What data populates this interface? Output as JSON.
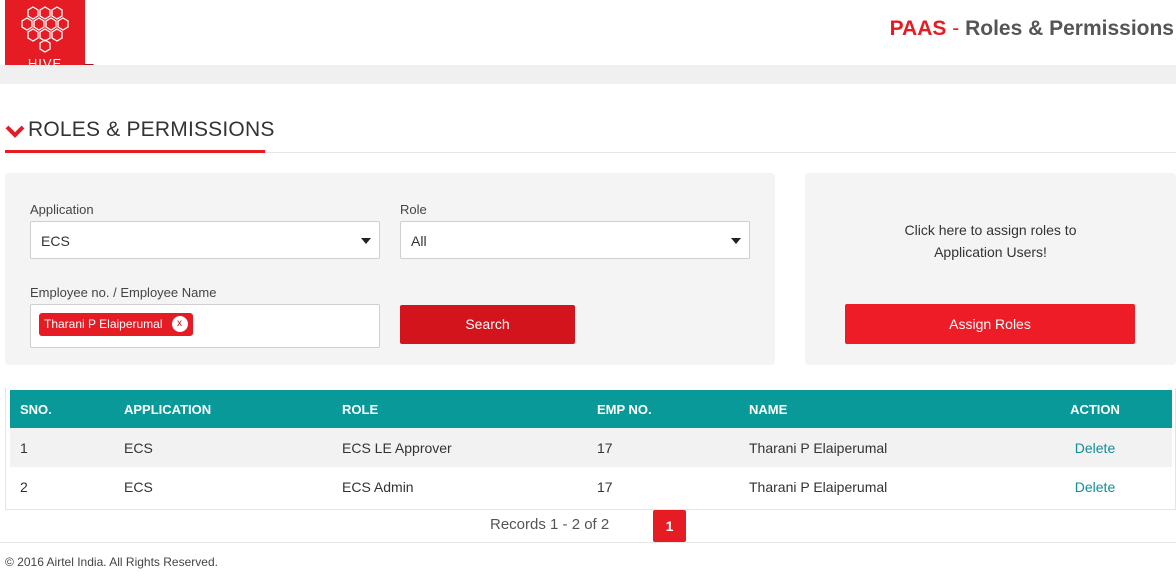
{
  "header": {
    "logo_text": "HIVE",
    "brand": "PAAS",
    "separator": "-",
    "title": "Roles & Permissions"
  },
  "section": {
    "title": "ROLES & PERMISSIONS",
    "icon": "chevron-down-icon"
  },
  "filters": {
    "application_label": "Application",
    "application_value": "ECS",
    "role_label": "Role",
    "role_value": "All",
    "employee_label": "Employee no. / Employee Name",
    "employee_tag": "Tharani P Elaiperumal",
    "tag_remove": "x",
    "search_button": "Search"
  },
  "assign": {
    "text_line1": "Click here to assign roles to",
    "text_line2": "Application Users!",
    "button": "Assign Roles"
  },
  "table": {
    "columns": [
      "SNO.",
      "APPLICATION",
      "ROLE",
      "EMP NO.",
      "NAME",
      "ACTION"
    ],
    "rows": [
      {
        "sno": "1",
        "application": "ECS",
        "role": "ECS LE Approver",
        "emp_no": "17",
        "name": "Tharani P Elaiperumal",
        "action": "Delete"
      },
      {
        "sno": "2",
        "application": "ECS",
        "role": "ECS Admin",
        "emp_no": "17",
        "name": "Tharani P Elaiperumal",
        "action": "Delete"
      }
    ]
  },
  "pagination": {
    "records": "Records 1 - 2 of 2",
    "current_page": "1"
  },
  "footer": {
    "copyright": "© 2016 Airtel India. All Rights Reserved."
  },
  "colors": {
    "brand_red": "#e61c24",
    "teal_header": "#0a9999",
    "link_teal": "#138e95"
  }
}
